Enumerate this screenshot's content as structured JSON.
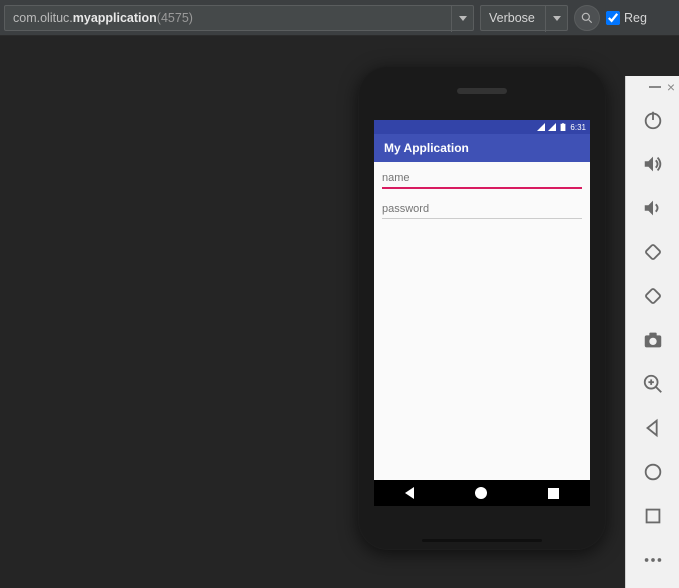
{
  "toolbar": {
    "app_prefix": "com.olituc.",
    "app_bold": "myapplication",
    "app_pid": " (4575)",
    "log_level": "Verbose",
    "regex_label": "Reg"
  },
  "emulator": {
    "statusbar": {
      "time": "6:31"
    },
    "appbar": {
      "title": "My Application"
    },
    "fields": {
      "name_placeholder": "name",
      "password_placeholder": "password"
    }
  },
  "sidepanel": {
    "buttons": [
      "power",
      "volume-up",
      "volume-down",
      "rotate-left",
      "rotate-right",
      "camera",
      "zoom-in",
      "back",
      "home",
      "recent",
      "more"
    ]
  }
}
